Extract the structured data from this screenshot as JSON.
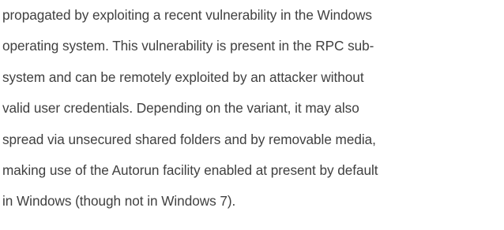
{
  "document": {
    "lines": [
      "propagated by exploiting a recent vulnerability in the Windows",
      "operating system. This vulnerability is present in the RPC sub-",
      "system and can be remotely exploited by an attacker without",
      "valid user credentials. Depending on the variant, it may also",
      "spread via unsecured shared folders and by removable media,",
      "making use of the Autorun facility enabled at present by default",
      "in Windows (though not in Windows 7)."
    ]
  }
}
